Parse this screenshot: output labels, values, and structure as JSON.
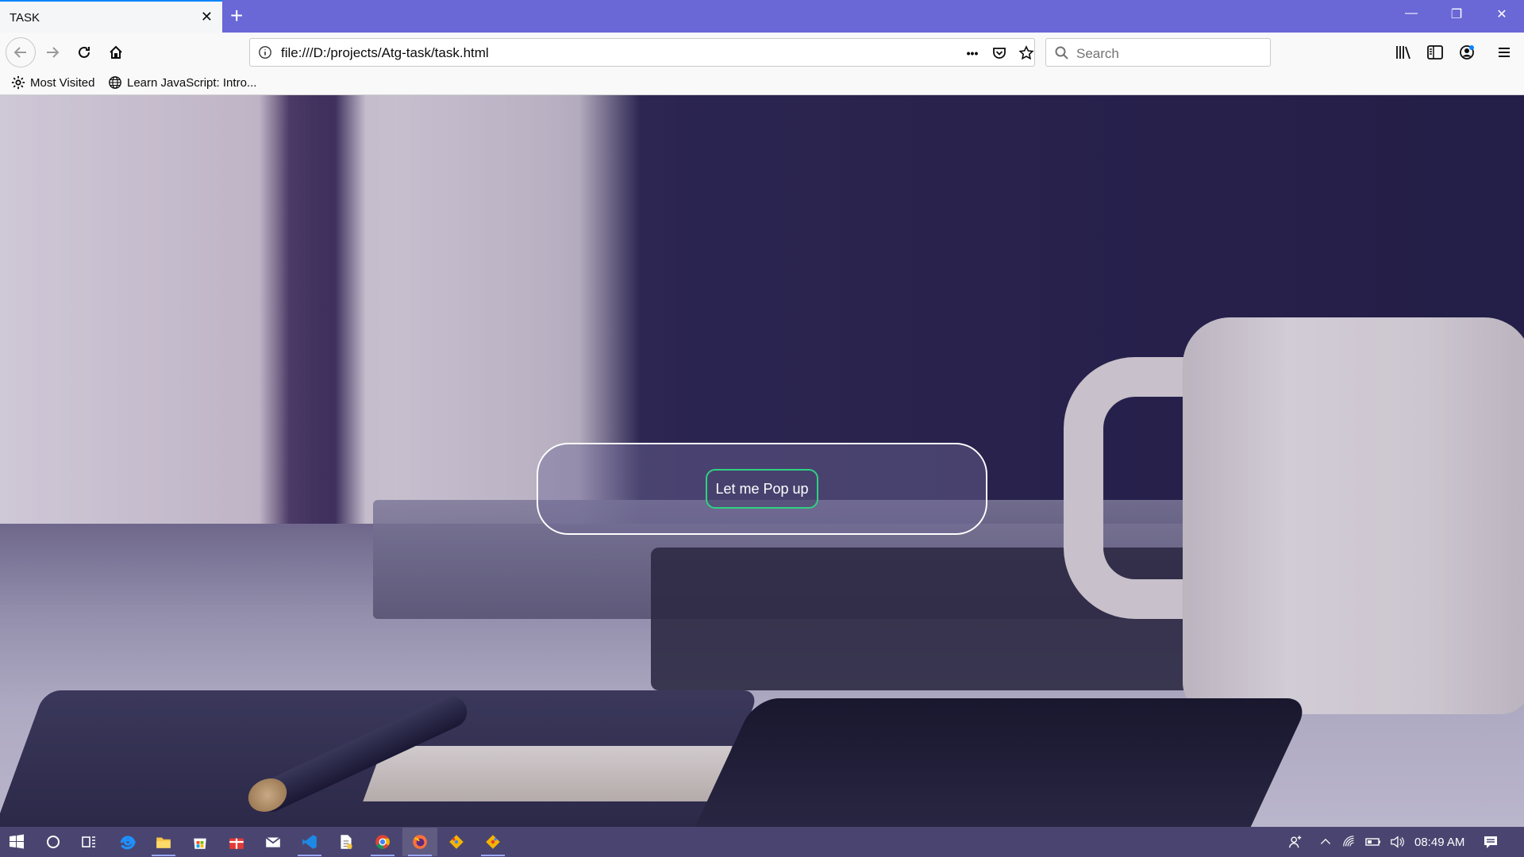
{
  "browser": {
    "tab": {
      "title": "TASK",
      "close_glyph": "✕"
    },
    "new_tab_glyph": "+",
    "window_controls": {
      "minimize": "—",
      "restore": "❐",
      "close": "✕"
    },
    "url": "file:///D:/projects/Atg-task/task.html",
    "search_placeholder": "Search",
    "page_actions_glyph": "•••",
    "bookmarks": [
      {
        "label": "Most Visited",
        "icon": "gear-icon"
      },
      {
        "label": "Learn JavaScript: Intro...",
        "icon": "globe-icon"
      }
    ]
  },
  "page": {
    "popup_button_label": "Let me Pop up",
    "accent_color": "#2fd181"
  },
  "taskbar": {
    "time": "08:49 AM",
    "apps": [
      "start-icon",
      "cortana-icon",
      "task-view-icon",
      "edge-icon",
      "file-explorer-icon",
      "store-icon",
      "gift-icon",
      "mail-icon",
      "vscode-icon",
      "document-icon",
      "chrome-icon",
      "firefox-icon",
      "git-icon",
      "git-icon-2"
    ]
  }
}
